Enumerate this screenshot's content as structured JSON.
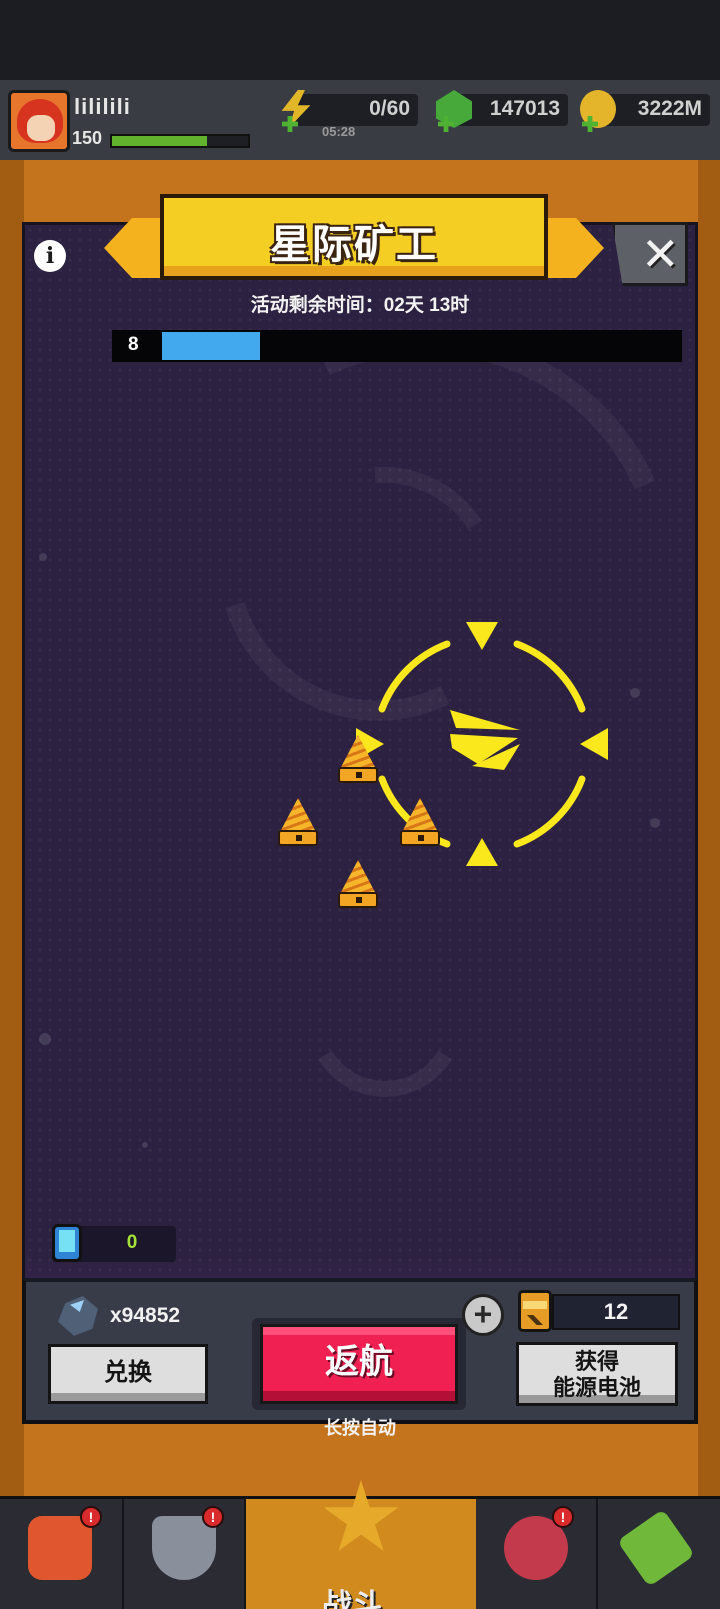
{
  "hud": {
    "player_name": "lililili",
    "player_level": "150",
    "xp_progress": 0.7,
    "energy": "0/60",
    "energy_timer": "05:28",
    "gems": "147013",
    "gold": "3222M"
  },
  "event": {
    "title": "星际矿工",
    "remaining_time": "活动剩余时间：02天 13时",
    "level": "8",
    "level_progress": 0.19,
    "info_icon": "info-icon",
    "close_icon": "close-icon"
  },
  "mining": {
    "crystal_count": "0",
    "drill_count": 4,
    "target_icon": "crosshair-icon"
  },
  "controls": {
    "ore_count": "x94852",
    "exchange_label": "兑换",
    "return_label": "返航",
    "auto_hint": "长按自动",
    "battery_count": "12",
    "battery_label_line1": "获得",
    "battery_label_line2": "能源电池",
    "add_icon": "plus-icon"
  },
  "bottom_nav": {
    "battle_label": "战斗",
    "items": [
      "shop-icon",
      "armor-icon",
      "battle-icon",
      "star-ball-icon",
      "pass-card-icon"
    ]
  },
  "colors": {
    "accent_yellow": "#f4ce22",
    "return_red": "#f02152",
    "progress_blue": "#42a9ee",
    "modal_bg": "#2c2140",
    "xp_green": "#63b22e"
  }
}
